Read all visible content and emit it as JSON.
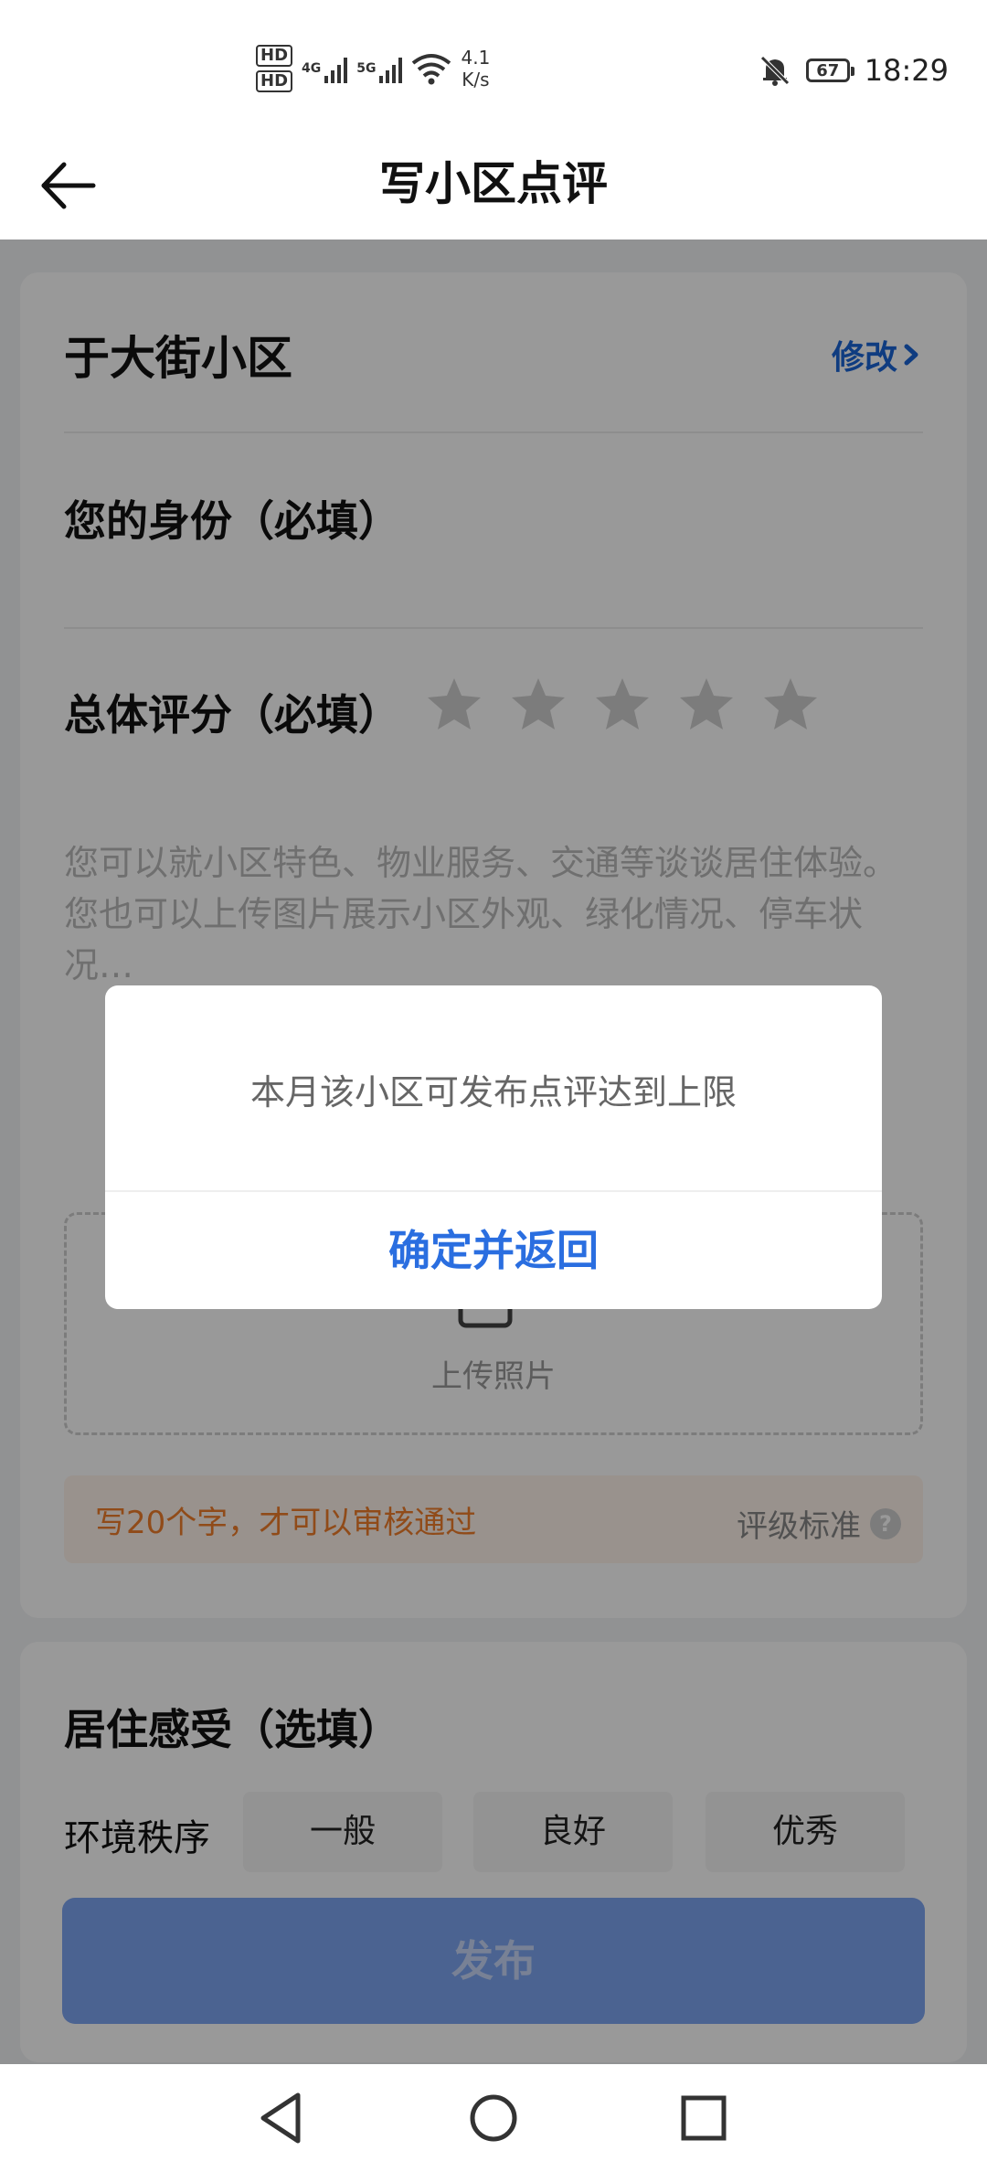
{
  "status_bar": {
    "hd1": "HD",
    "hd2": "HD",
    "net1": "4G",
    "net2": "5G",
    "speed_value": "4.1",
    "speed_unit": "K/s",
    "battery": "67",
    "time": "18:29"
  },
  "header": {
    "title": "写小区点评"
  },
  "form": {
    "community_name": "于大街小区",
    "modify_label": "修改",
    "identity_label": "您的身份（必填）",
    "overall_rating_label": "总体评分（必填）",
    "rating_stars": 5,
    "placeholder": "您可以就小区特色、物业服务、交通等谈谈居住体验。\n您也可以上传图片展示小区外观、绿化情况、停车状况…",
    "upload_label": "上传照片",
    "tip": "写20个字，才可以审核通过",
    "rating_standard": "评级标准",
    "living_section_label": "居住感受（选填）",
    "environment_label": "环境秩序",
    "environment_options": [
      "一般",
      "良好",
      "优秀"
    ],
    "publish_label": "发布"
  },
  "dialog": {
    "message": "本月该小区可发布点评达到上限",
    "confirm_label": "确定并返回"
  },
  "colors": {
    "accent": "#1a64d6",
    "tip": "#f07d2a",
    "publish_button": "#7ea6f2"
  }
}
